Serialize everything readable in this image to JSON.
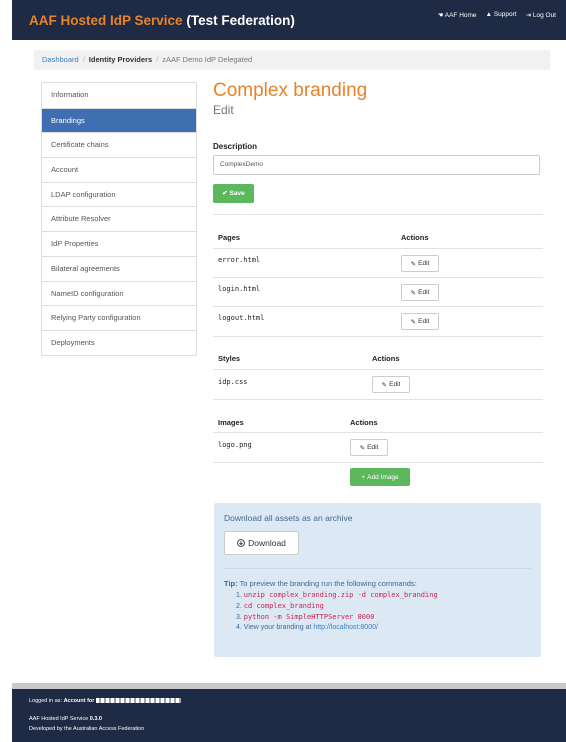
{
  "app": {
    "title_main": "AAF Hosted IdP Service",
    "title_federation": "(Test Federation)"
  },
  "topnav": {
    "home": "AAF Home",
    "support": "Support",
    "logout": "Log Out"
  },
  "breadcrumb": {
    "dashboard": "Dashboard",
    "identity_providers": "Identity Providers",
    "current": "zAAF Demo IdP Delegated"
  },
  "sidebar": {
    "items": [
      {
        "label": "Information"
      },
      {
        "label": "Brandings"
      },
      {
        "label": "Certificate chains"
      },
      {
        "label": "Account"
      },
      {
        "label": "LDAP configuration"
      },
      {
        "label": "Attribute Resolver"
      },
      {
        "label": "IdP Properties"
      },
      {
        "label": "Bilateral agreements"
      },
      {
        "label": "NameID configuration"
      },
      {
        "label": "Relying Party configuration"
      },
      {
        "label": "Deployments"
      }
    ],
    "active": "Brandings"
  },
  "main": {
    "title": "Complex branding",
    "subtitle": "Edit",
    "description_label": "Description",
    "description_value": "ComplexDemo",
    "save_label": "Save"
  },
  "pages": {
    "header": "Pages",
    "actions_header": "Actions",
    "rows": [
      {
        "file": "error.html",
        "action": "Edit"
      },
      {
        "file": "login.html",
        "action": "Edit"
      },
      {
        "file": "logout.html",
        "action": "Edit"
      }
    ]
  },
  "styles": {
    "header": "Styles",
    "actions_header": "Actions",
    "rows": [
      {
        "file": "idp.css",
        "action": "Edit"
      }
    ]
  },
  "images": {
    "header": "Images",
    "actions_header": "Actions",
    "rows": [
      {
        "file": "logo.png",
        "action": "Edit"
      }
    ],
    "add_label": "Add Image"
  },
  "download": {
    "title": "Download all assets as an archive",
    "button": "Download",
    "tip_label": "Tip:",
    "tip_text": "To preview the branding run the following commands:",
    "steps": [
      {
        "num": "1.",
        "cmd": "unzip complex_branding.zip -d complex_branding"
      },
      {
        "num": "2.",
        "cmd": "cd complex_branding"
      },
      {
        "num": "3.",
        "cmd": "python -m SimpleHTTPServer 8000"
      },
      {
        "num": "4.",
        "text": "View your branding at ",
        "url": "http://localhost:8000/"
      }
    ]
  },
  "footer": {
    "logged_in_prefix": "Logged in as:",
    "account_prefix": "Account for",
    "service_prefix": "AAF Hosted IdP Service",
    "version": "0.3.0",
    "developed_by": "Developed by the Australian Access Federation"
  },
  "colors": {
    "navbar": "#1f2a44",
    "brand_orange": "#e8832a",
    "active_blue": "#3f6fb0",
    "save_green": "#5cb85c",
    "panel_blue": "#dce9f5",
    "code_red": "#c7254e"
  }
}
